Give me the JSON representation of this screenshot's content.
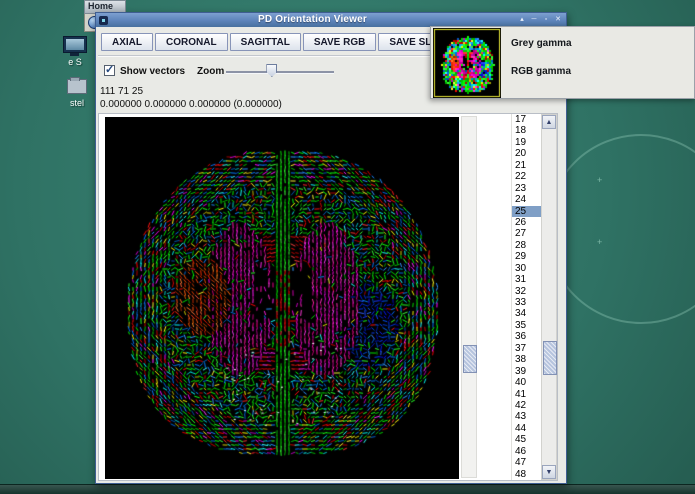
{
  "colors": {
    "desktop": "#3a8675",
    "titlebar": "#5d83ba",
    "titlebar_light": "#7da0d0",
    "selection": "#7f9fc6",
    "thumb_border": "#e8e838"
  },
  "desktop": {
    "home_window": {
      "title": "Home"
    },
    "icons": [
      {
        "label": "e S"
      },
      {
        "label": "stel"
      }
    ],
    "ornament_marks": [
      "+",
      "+"
    ]
  },
  "viewer": {
    "title": "PD Orientation Viewer",
    "window_controls": [
      {
        "name": "shade-button",
        "glyph": "▴"
      },
      {
        "name": "minimize-button",
        "glyph": "─"
      },
      {
        "name": "maximize-button",
        "glyph": "▫"
      },
      {
        "name": "close-button",
        "glyph": "✕"
      }
    ],
    "toolbar_buttons": [
      "AXIAL",
      "CORONAL",
      "SAGITTAL",
      "SAVE RGB",
      "SAVE SLICES"
    ],
    "show_vectors_label": "Show vectors",
    "show_vectors_checked": true,
    "check_glyph": "✓",
    "zoom_label": "Zoom",
    "zoom_percent": 42,
    "coords_line": "111 71 25",
    "values_line": "0.000000 0.000000 0.000000 (0.000000)",
    "gamma_panel": {
      "grey_label": "Grey gamma",
      "rgb_label": "RGB gamma"
    },
    "slice_list": {
      "items": [
        "17",
        "18",
        "19",
        "20",
        "21",
        "22",
        "23",
        "24",
        "25",
        "26",
        "27",
        "28",
        "29",
        "30",
        "31",
        "32",
        "33",
        "34",
        "35",
        "36",
        "37",
        "38",
        "39",
        "40",
        "41",
        "42",
        "43",
        "44",
        "45",
        "46",
        "47",
        "48"
      ],
      "selected": "25"
    },
    "scroll_icons": {
      "up": "▲",
      "down": "▼"
    }
  },
  "canvas_art": {
    "seed": 7,
    "background": "#000000"
  }
}
